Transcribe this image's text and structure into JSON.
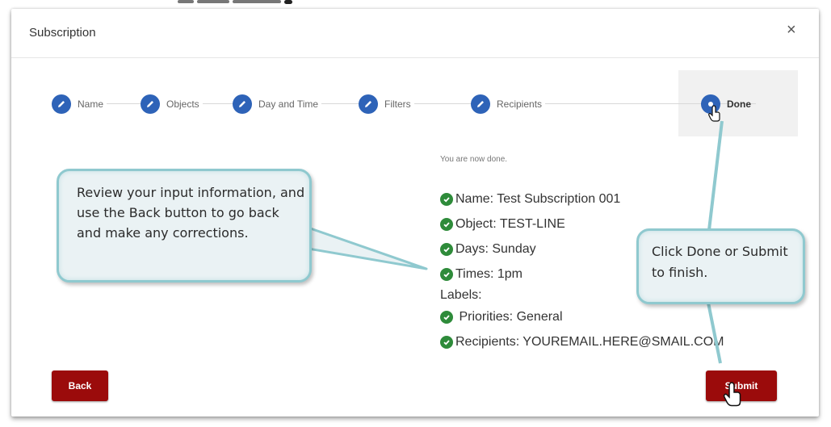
{
  "dialog": {
    "title": "Subscription",
    "close_glyph": "×"
  },
  "steps": [
    {
      "label": "Name",
      "icon": "pencil-icon"
    },
    {
      "label": "Objects",
      "icon": "pencil-icon"
    },
    {
      "label": "Day and Time",
      "icon": "pencil-icon"
    },
    {
      "label": "Filters",
      "icon": "pencil-icon"
    },
    {
      "label": "Recipients",
      "icon": "pencil-icon"
    },
    {
      "label": "Done",
      "icon": "step-dot-icon"
    }
  ],
  "summary": {
    "heading": "You are now done.",
    "name": "Name: Test Subscription 001",
    "object": "Object: TEST-LINE",
    "days": "Days: Sunday",
    "times": "Times: 1pm",
    "labels": "Labels:",
    "priorities": " Priorities: General",
    "recipients": "Recipients: YOUREMAIL.HERE@SMAIL.COM"
  },
  "buttons": {
    "back": "Back",
    "submit": "Submit"
  },
  "callouts": {
    "left": "Review your input information, and use the Back button to go back and make any corrections.",
    "right": "Click Done or Submit to finish."
  },
  "colors": {
    "step_blue": "#2e63b8",
    "check_green": "#2e8b3a",
    "button_red": "#9b0b0b",
    "callout_border": "#8fc9cf",
    "callout_fill": "#eaf2f4"
  }
}
